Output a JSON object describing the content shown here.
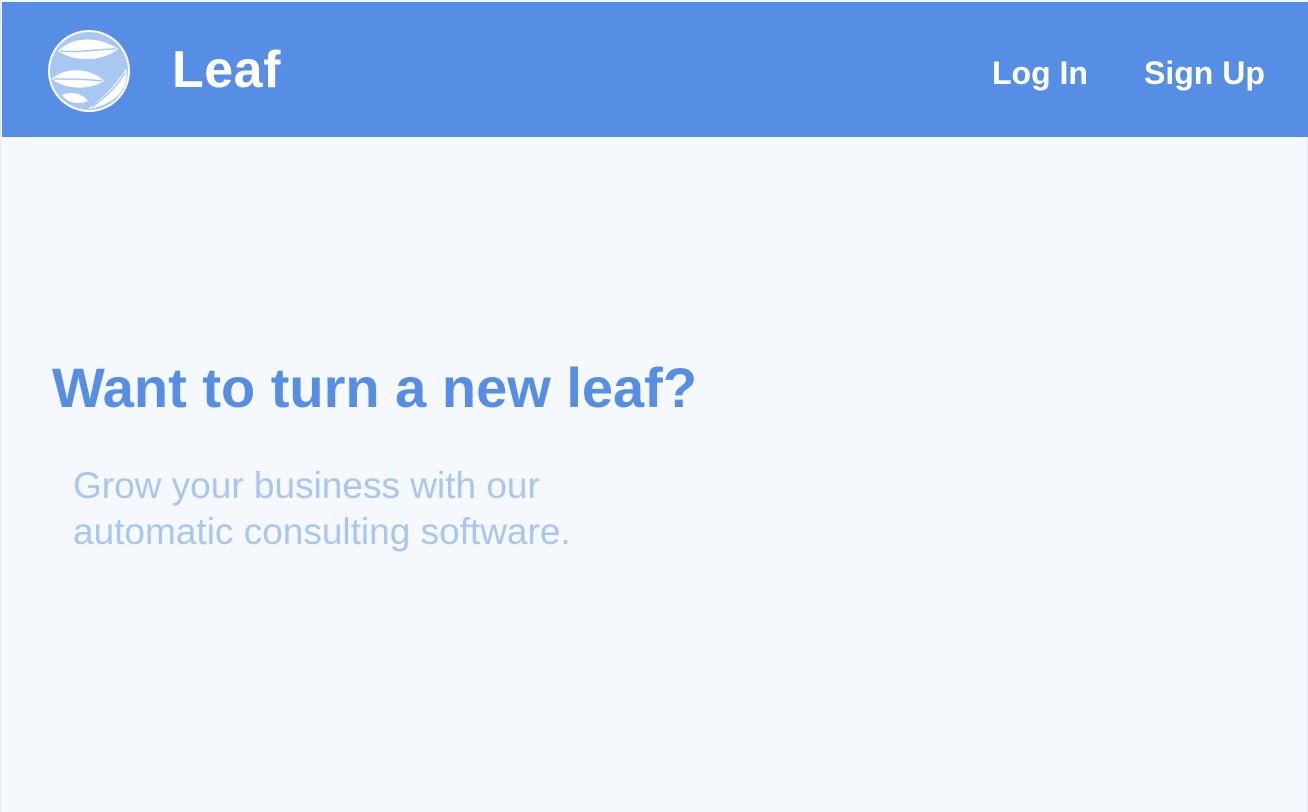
{
  "header": {
    "brand": "Leaf",
    "logo_icon": "leaf-logo-icon",
    "nav": {
      "login_label": "Log In",
      "signup_label": "Sign Up"
    }
  },
  "hero": {
    "title": "Want to turn a new leaf?",
    "subtitle_line1": "Grow your business with our",
    "subtitle_line2": "automatic consulting software."
  },
  "colors": {
    "primary": "#568ee5",
    "background": "#f5f9fe",
    "subtitle": "#a8c6ef",
    "nav_text": "#ffffff"
  }
}
